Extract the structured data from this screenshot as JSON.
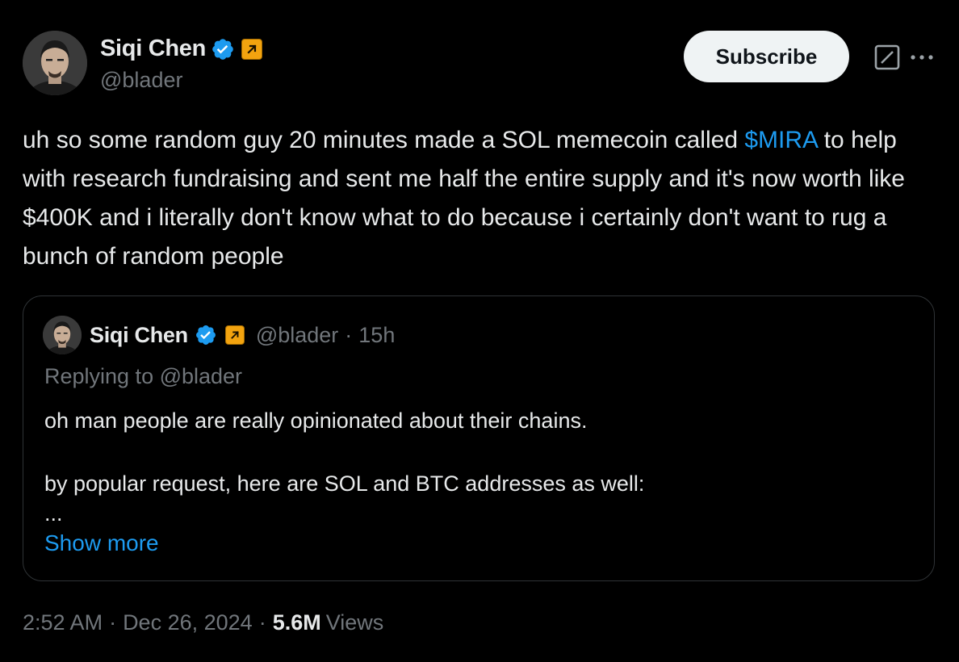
{
  "author": {
    "name": "Siqi Chen",
    "handle": "@blader",
    "verified_color": "#1d9bf0",
    "affiliate_color": "#f2a30f"
  },
  "actions": {
    "subscribe_label": "Subscribe",
    "grok_icon": "grok-icon",
    "more_icon": "more-icon"
  },
  "tweet": {
    "text_before_cashtag": "uh so some random guy 20 minutes made a SOL memecoin called ",
    "cashtag": "$MIRA",
    "text_after_cashtag": " to help with research fundraising and sent me half the entire supply and it's now worth like $400K and i literally don't know what to do because i certainly don't want to rug a bunch of random people"
  },
  "quoted": {
    "name": "Siqi Chen",
    "handle": "@blader",
    "dot": "·",
    "time": "15h",
    "replying_to": "Replying to @blader",
    "line1": "oh man people are really opinionated about their chains.",
    "line2": "by popular request, here are SOL and BTC addresses as well:",
    "ellipsis": "...",
    "show_more": "Show more"
  },
  "meta": {
    "time": "2:52 AM",
    "sep1": "·",
    "date": "Dec 26, 2024",
    "sep2": "·",
    "views_count": "5.6M",
    "views_label": "Views"
  }
}
